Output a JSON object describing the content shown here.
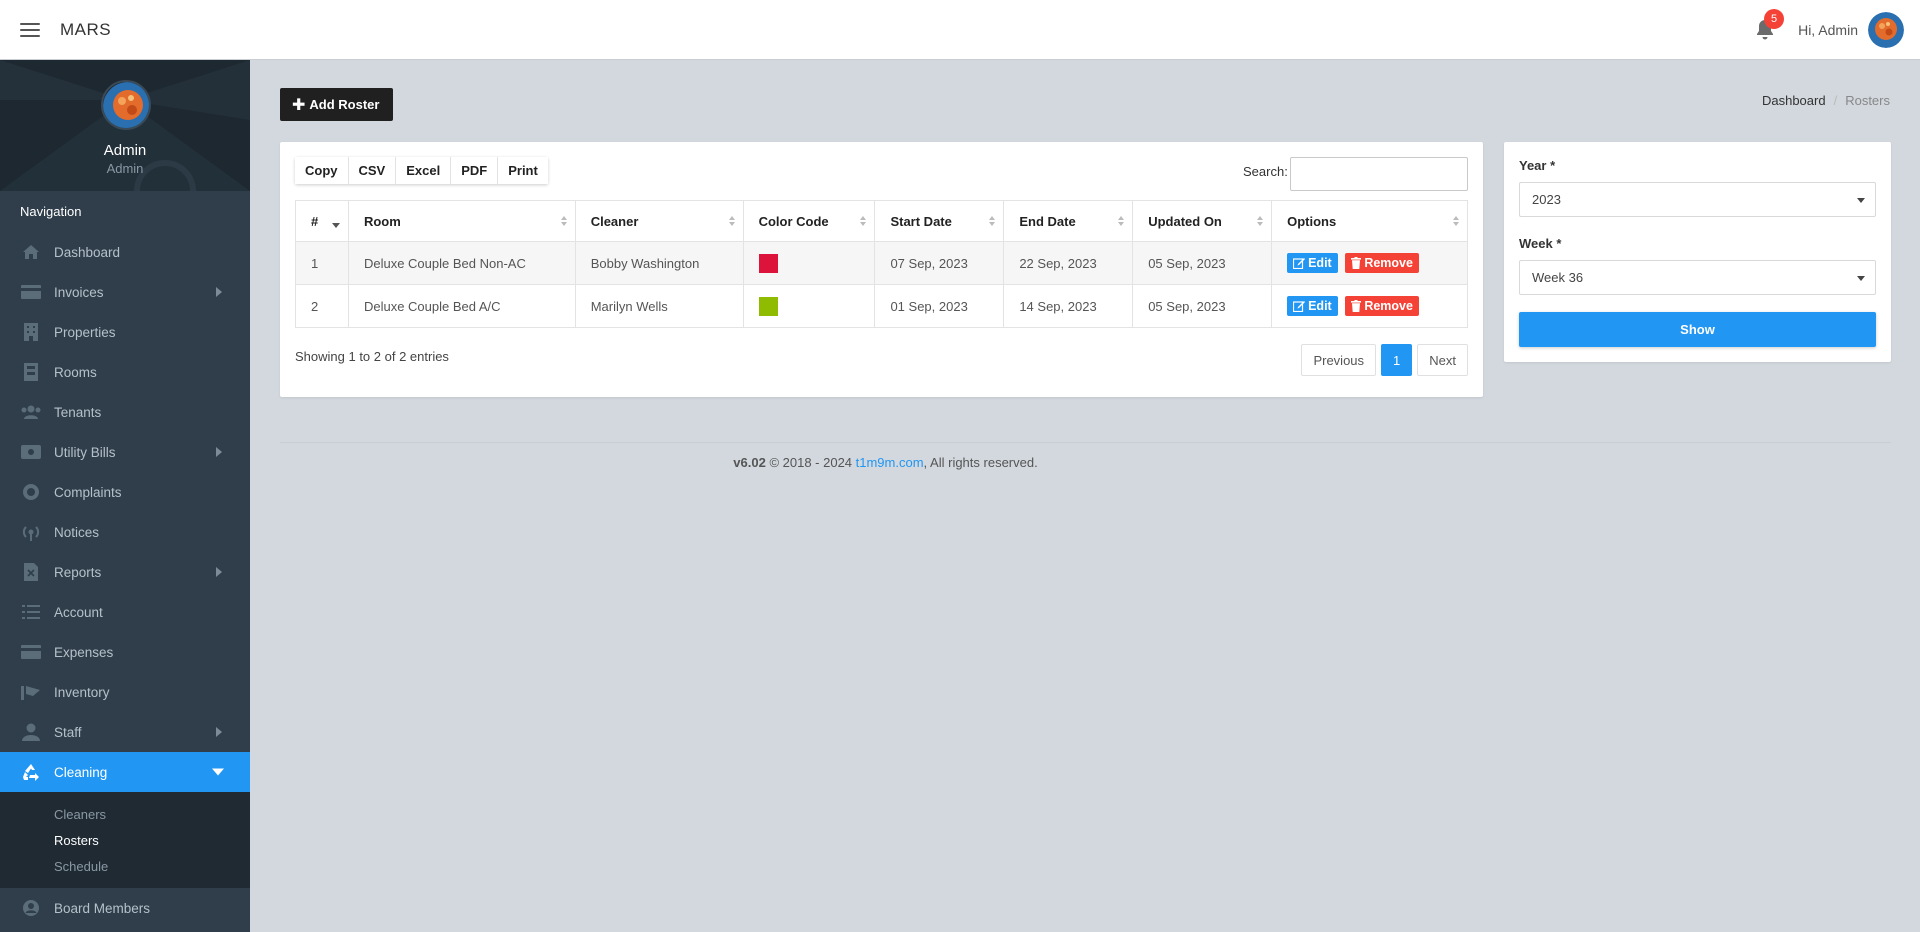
{
  "app": {
    "title": "MARS"
  },
  "header": {
    "notification_count": "5",
    "greeting": "Hi, Admin"
  },
  "profile": {
    "name": "Admin",
    "role": "Admin"
  },
  "sidebar": {
    "heading": "Navigation",
    "items": [
      {
        "label": "Dashboard",
        "icon": "dashboard-icon"
      },
      {
        "label": "Invoices",
        "icon": "invoice-icon",
        "has_children": true
      },
      {
        "label": "Properties",
        "icon": "building-icon"
      },
      {
        "label": "Rooms",
        "icon": "room-icon"
      },
      {
        "label": "Tenants",
        "icon": "users-icon"
      },
      {
        "label": "Utility Bills",
        "icon": "bill-icon",
        "has_children": true
      },
      {
        "label": "Complaints",
        "icon": "lifebuoy-icon"
      },
      {
        "label": "Notices",
        "icon": "broadcast-icon"
      },
      {
        "label": "Reports",
        "icon": "report-icon",
        "has_children": true
      },
      {
        "label": "Account",
        "icon": "list-icon"
      },
      {
        "label": "Expenses",
        "icon": "card-icon"
      },
      {
        "label": "Inventory",
        "icon": "inventory-icon"
      },
      {
        "label": "Staff",
        "icon": "user-icon",
        "has_children": true
      },
      {
        "label": "Cleaning",
        "icon": "recycle-icon",
        "active": true,
        "has_children": true
      }
    ],
    "submenu": [
      {
        "label": "Cleaners"
      },
      {
        "label": "Rosters",
        "current": true
      },
      {
        "label": "Schedule"
      }
    ],
    "after": {
      "label": "Board Members",
      "icon": "member-icon"
    }
  },
  "page": {
    "add_button": "Add Roster"
  },
  "breadcrumb": {
    "home": "Dashboard",
    "current": "Rosters"
  },
  "export_buttons": [
    "Copy",
    "CSV",
    "Excel",
    "PDF",
    "Print"
  ],
  "search": {
    "label": "Search:",
    "value": ""
  },
  "table": {
    "columns": [
      "#",
      "Room",
      "Cleaner",
      "Color Code",
      "Start Date",
      "End Date",
      "Updated On",
      "Options"
    ],
    "rows": [
      {
        "num": "1",
        "room": "Deluxe Couple Bed Non-AC",
        "cleaner": "Bobby Washington",
        "color": "#dc143c",
        "start": "07 Sep, 2023",
        "end": "22 Sep, 2023",
        "updated": "05 Sep, 2023"
      },
      {
        "num": "2",
        "room": "Deluxe Couple Bed A/C",
        "cleaner": "Marilyn Wells",
        "color": "#8fbc00",
        "start": "01 Sep, 2023",
        "end": "14 Sep, 2023",
        "updated": "05 Sep, 2023"
      }
    ],
    "edit_label": "Edit",
    "remove_label": "Remove",
    "info": "Showing 1 to 2 of 2 entries"
  },
  "pagination": {
    "previous": "Previous",
    "current": "1",
    "next": "Next"
  },
  "filter": {
    "year_label": "Year *",
    "year_value": "2023",
    "week_label": "Week *",
    "week_value": "Week 36",
    "show_button": "Show"
  },
  "footer": {
    "version": "v6.02",
    "copyright": " © 2018 - 2024 ",
    "link": "t1m9m.com",
    "rights": ", All rights reserved."
  },
  "colors": {
    "accent": "#2196f3",
    "danger": "#f44336",
    "sidebar": "#2f3e4a"
  }
}
